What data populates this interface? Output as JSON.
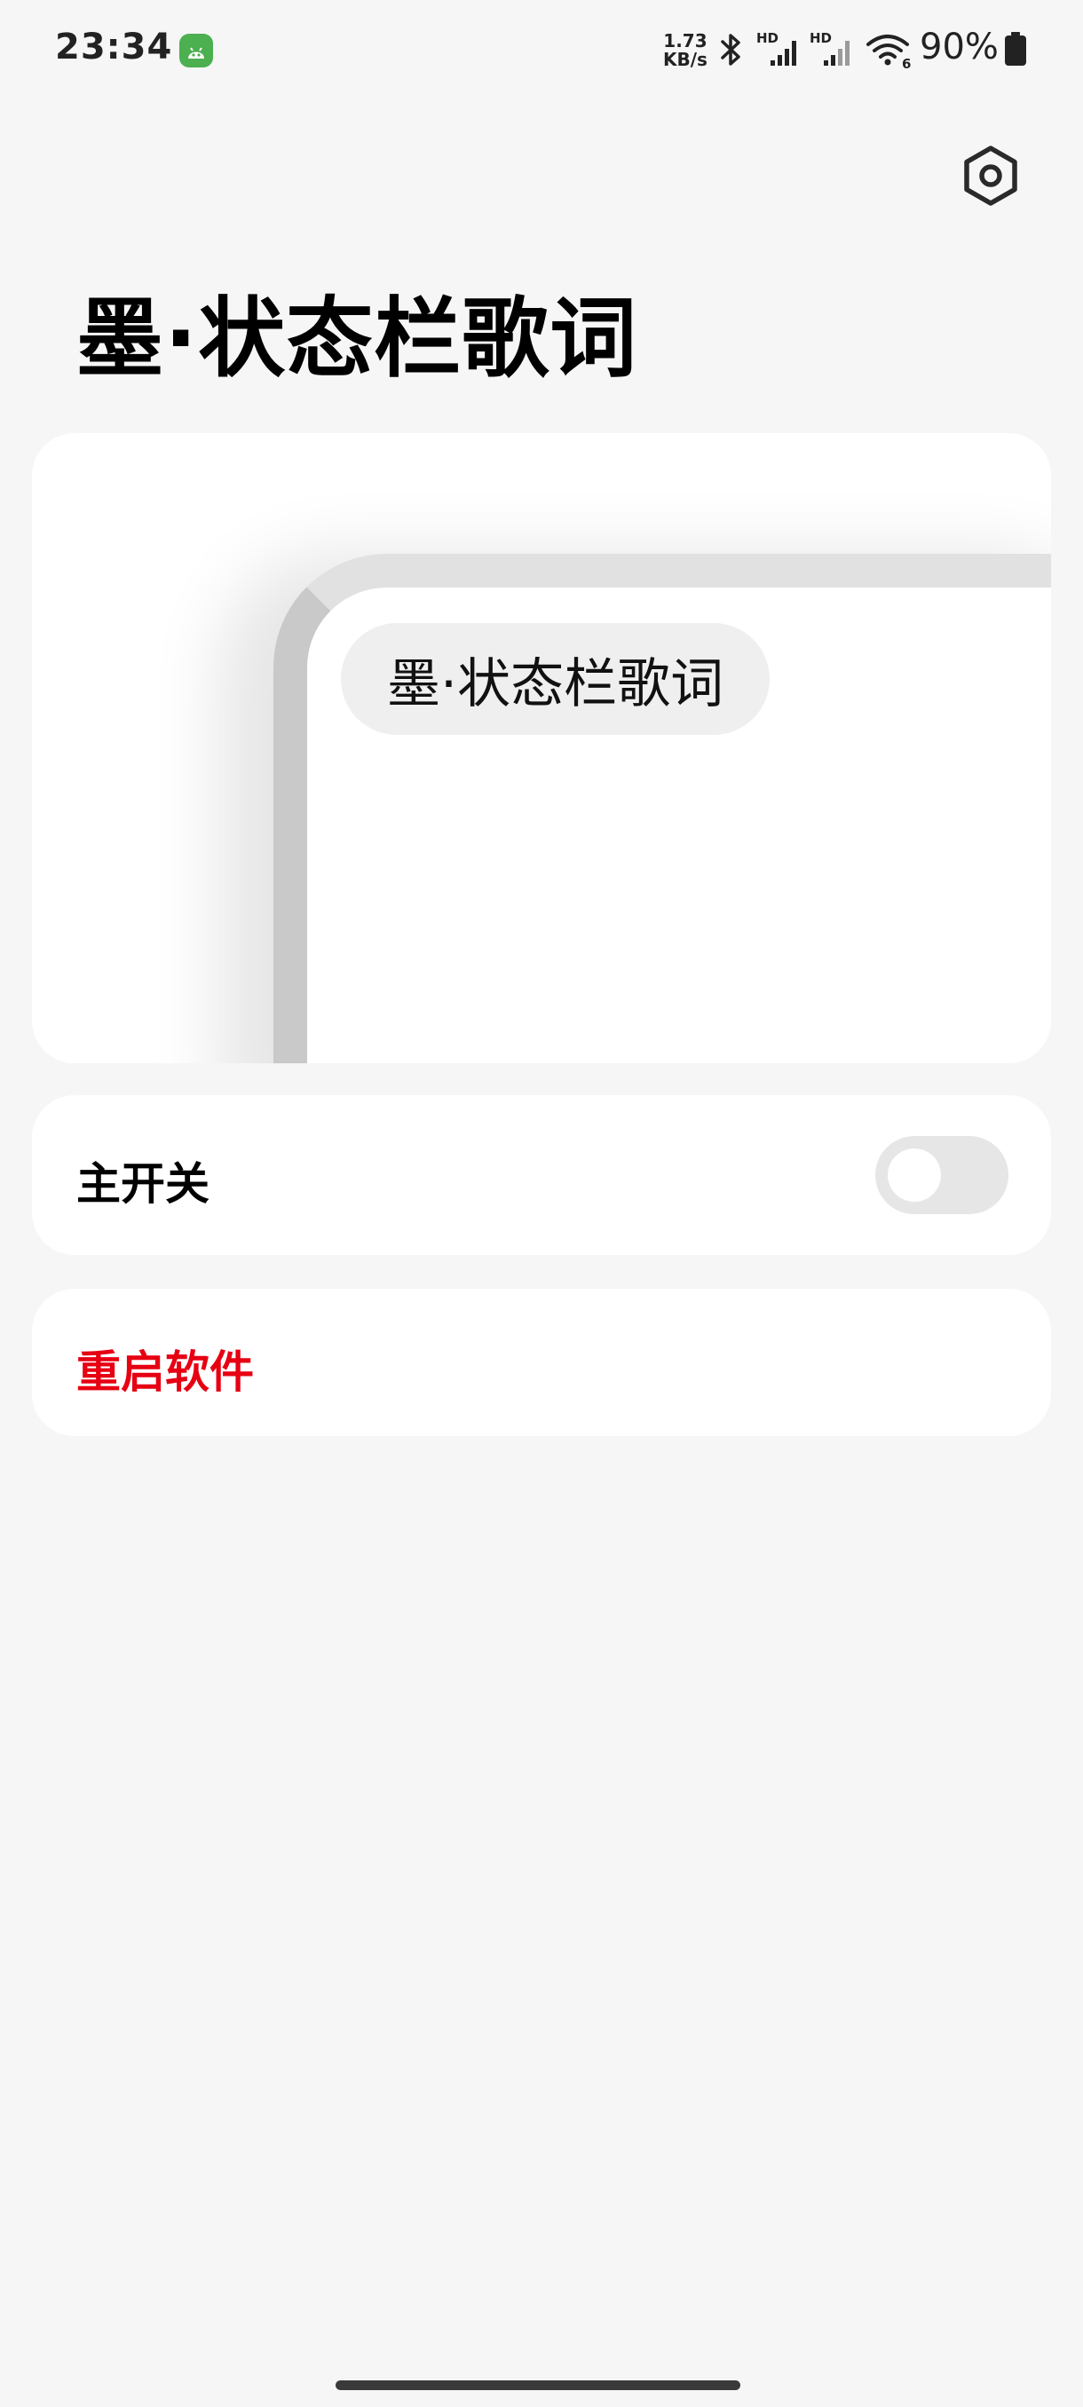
{
  "status_bar": {
    "time": "23:34",
    "net_speed_value": "1.73",
    "net_speed_unit": "KB/s",
    "signal1_label": "HD",
    "signal2_label": "HD",
    "wifi_badge": "6",
    "battery_percent": "90%",
    "icons": [
      "app-notification-icon",
      "bluetooth-icon",
      "signal-icon",
      "wifi-icon",
      "battery-icon"
    ]
  },
  "header": {
    "title": "墨·状态栏歌词",
    "settings_icon": "settings-icon"
  },
  "preview": {
    "lyric_text": "墨·状态栏歌词"
  },
  "main_switch": {
    "label": "主开关",
    "on": false
  },
  "restart": {
    "label": "重启软件",
    "color": "#e60012"
  }
}
